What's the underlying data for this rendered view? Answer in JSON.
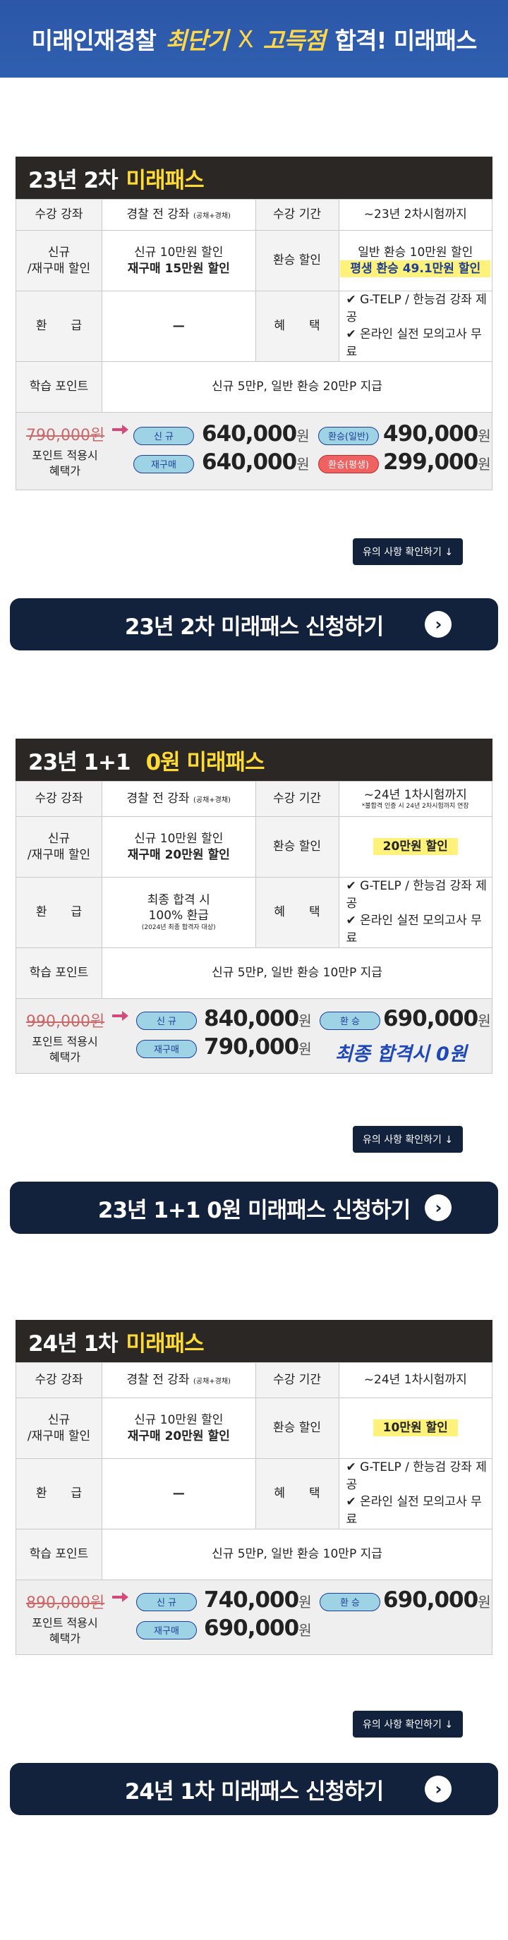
{
  "banner": {
    "part1": "미래인재경찰",
    "part2": "최단기",
    "x": "X",
    "part3": "고득점",
    "part4": "합격! 미래패스"
  },
  "sections": [
    {
      "head_a": "23년 2차",
      "head_b": "미래패스",
      "lab_course": "수강 강좌",
      "course": "경찰 전 강좌",
      "course_small": "(공채+경채)",
      "lab_period": "수강 기간",
      "period": "~23년 2차시험까지",
      "period_note": "",
      "lab_discount": "신규\n/재구매 할인",
      "discount_1": "신규 10만원 할인",
      "discount_2": "재구매 15만원 할인",
      "lab_refund_discount": "환승 할인",
      "refund_discount_1": "일반 환승 10만원 할인",
      "refund_discount_2": "평생 환승 49.1만원 할인",
      "lab_refund": "환　　급",
      "refund": "—",
      "refund_note": "",
      "lab_benefit": "혜　　택",
      "benefit_1": "✔ G-TELP / 한능검 강좌 제공",
      "benefit_2": "✔ 온라인 실전 모의고사 무료",
      "lab_point": "학습 포인트",
      "point": "신규 5만P, 일반 환승 20만P 지급",
      "original": "790,000원",
      "point_label": "포인트 적용시\n혜택가",
      "pill_new": "신 규",
      "price_new": "640,000",
      "pill_re": "재구매",
      "price_re": "640,000",
      "pill_t1": "환승(일반)",
      "price_t1": "490,000",
      "pill_t2": "환승(평생)",
      "price_t2": "299,000",
      "won": "원",
      "notice": "유의 사항 확인하기 ↓",
      "apply": "23년 2차 미래패스 신청하기"
    },
    {
      "head_a": "23년 1+1",
      "head_b": "0원 미래패스",
      "lab_course": "수강 강좌",
      "course": "경찰 전 강좌",
      "course_small": "(공채+경채)",
      "lab_period": "수강 기간",
      "period": "~24년 1차시험까지",
      "period_note": "*불합격 인증 시 24년 2차시험까지 연장",
      "lab_discount": "신규\n/재구매 할인",
      "discount_1": "신규 10만원 할인",
      "discount_2": "재구매 20만원 할인",
      "lab_refund_discount": "환승 할인",
      "refund_discount_1": "20만원 할인",
      "refund_discount_2": "",
      "lab_refund": "환　　급",
      "refund": "최종 합격 시\n100% 환급",
      "refund_note": "(2024년 최종 합격자 대상)",
      "lab_benefit": "혜　　택",
      "benefit_1": "✔ G-TELP / 한능검 강좌 제공",
      "benefit_2": "✔ 온라인 실전 모의고사 무료",
      "lab_point": "학습 포인트",
      "point": "신규 5만P, 일반 환승 10만P 지급",
      "original": "990,000원",
      "point_label": "포인트 적용시\n혜택가",
      "pill_new": "신 규",
      "price_new": "840,000",
      "pill_re": "재구매",
      "price_re": "790,000",
      "pill_t1": "환 승",
      "price_t1": "690,000",
      "final_zero": "최종 합격시 0원",
      "won": "원",
      "notice": "유의 사항 확인하기 ↓",
      "apply": "23년 1+1 0원 미래패스 신청하기"
    },
    {
      "head_a": "24년 1차",
      "head_b": "미래패스",
      "lab_course": "수강 강좌",
      "course": "경찰 전 강좌",
      "course_small": "(공채+경채)",
      "lab_period": "수강 기간",
      "period": "~24년 1차시험까지",
      "lab_discount": "신규\n/재구매 할인",
      "discount_1": "신규 10만원 할인",
      "discount_2": "재구매 20만원 할인",
      "lab_refund_discount": "환승 할인",
      "refund_discount_1": "10만원 할인",
      "lab_refund": "환　　급",
      "refund": "—",
      "lab_benefit": "혜　　택",
      "benefit_1": "✔ G-TELP / 한능검 강좌 제공",
      "benefit_2": "✔ 온라인 실전 모의고사 무료",
      "lab_point": "학습 포인트",
      "point": "신규 5만P, 일반 환승 10만P 지급",
      "original": "890,000원",
      "point_label": "포인트 적용시\n혜택가",
      "pill_new": "신 규",
      "price_new": "740,000",
      "pill_re": "재구매",
      "price_re": "690,000",
      "pill_t1": "환 승",
      "price_t1": "690,000",
      "won": "원",
      "notice": "유의 사항 확인하기 ↓",
      "apply": "24년 1차 미래패스 신청하기"
    }
  ],
  "colors": {
    "banner": "#2c57a8",
    "header": "#2a2725",
    "accent_yellow": "#ffdb33",
    "button": "#12223c",
    "pill_teal": "#9ed3e6",
    "pill_red": "#f06262"
  }
}
